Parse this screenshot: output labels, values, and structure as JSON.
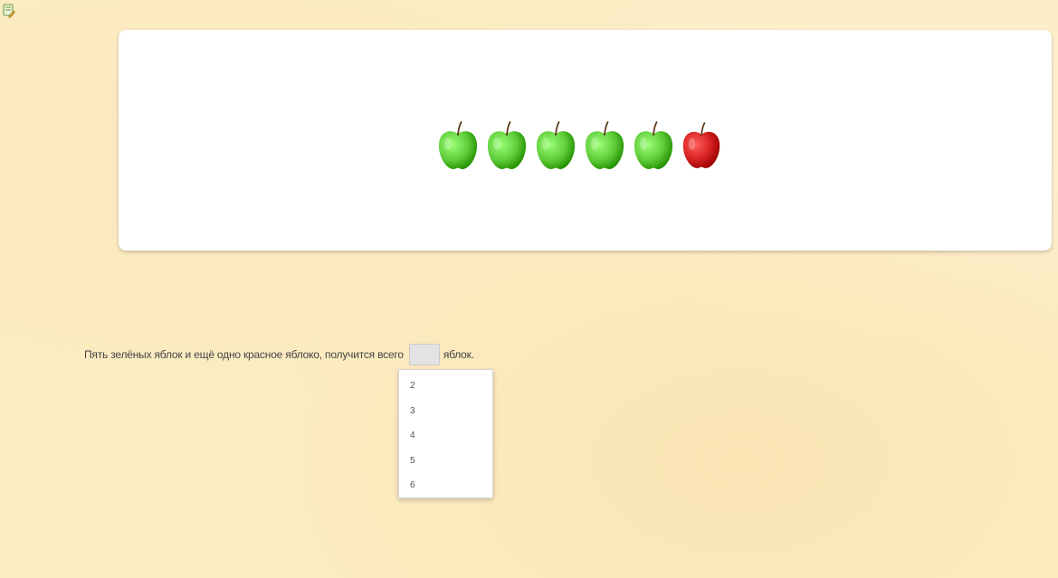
{
  "icons": {
    "corner": "edit-document-icon"
  },
  "apples": [
    {
      "color": "green",
      "hex": "#5fcc3a",
      "icon": "green-apple-icon"
    },
    {
      "color": "green",
      "hex": "#5fcc3a",
      "icon": "green-apple-icon"
    },
    {
      "color": "green",
      "hex": "#5fcc3a",
      "icon": "green-apple-icon"
    },
    {
      "color": "green",
      "hex": "#5fcc3a",
      "icon": "green-apple-icon"
    },
    {
      "color": "green",
      "hex": "#5fcc3a",
      "icon": "green-apple-icon"
    },
    {
      "color": "red",
      "hex": "#d62020",
      "icon": "red-apple-icon"
    }
  ],
  "question": {
    "text_before": "Пять зелёных яблок и ещё одно красное яблоко, получится всего",
    "answer_value": "",
    "text_after": "яблок."
  },
  "dropdown": {
    "options": [
      "2",
      "3",
      "4",
      "5",
      "6"
    ]
  }
}
